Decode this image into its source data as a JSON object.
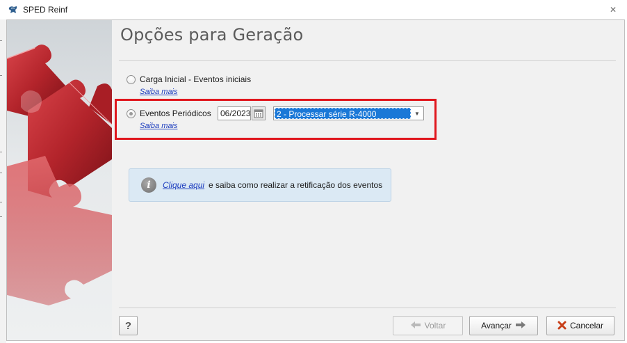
{
  "window": {
    "title": "SPED Reinf",
    "close_icon": "close-icon"
  },
  "page": {
    "title": "Opções para Geração"
  },
  "options": [
    {
      "label": "Carga Inicial - Eventos iniciais",
      "selected": false,
      "link": "Saiba mais"
    },
    {
      "label": "Eventos Periódicos",
      "selected": true,
      "link": "Saiba mais",
      "period_value": "06/2023",
      "calendar_icon": "calendar-icon",
      "series_selected": "2 - Processar série R-4000"
    }
  ],
  "highlight_color": "#e0161d",
  "info": {
    "icon": "info-icon",
    "link_text": "Clique aqui",
    "text": " e saiba como realizar a retificação dos eventos"
  },
  "footer": {
    "help_label": "?",
    "back_label": "Voltar",
    "next_label": "Avançar",
    "cancel_label": "Cancelar"
  },
  "colors": {
    "selection": "#1a78d7",
    "link": "#1f3fbf",
    "cancel_icon": "#c8401a"
  }
}
